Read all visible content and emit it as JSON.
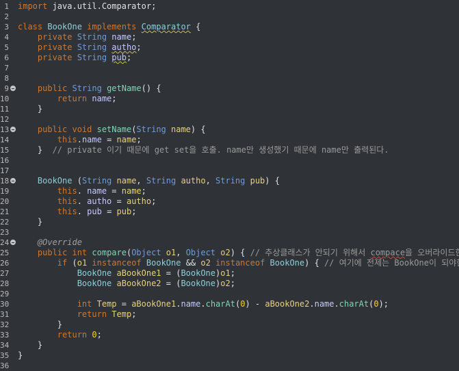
{
  "editor": {
    "lines": [
      [
        [
          "kw",
          "import "
        ],
        [
          "pl",
          "java.util.Comparator;"
        ]
      ],
      [],
      [
        [
          "kw",
          "class "
        ],
        [
          "cls",
          "BookOne "
        ],
        [
          "kw",
          "implements "
        ],
        [
          "cls",
          "Comparator",
          "warn"
        ],
        [
          "pl",
          " {"
        ]
      ],
      [
        [
          "pl",
          "    "
        ],
        [
          "kw",
          "private "
        ],
        [
          "ty",
          "String "
        ],
        [
          "fld",
          "name"
        ],
        [
          "pl",
          ";"
        ]
      ],
      [
        [
          "pl",
          "    "
        ],
        [
          "kw",
          "private "
        ],
        [
          "ty",
          "String "
        ],
        [
          "fld",
          "autho",
          "warn"
        ],
        [
          "pl",
          ";"
        ]
      ],
      [
        [
          "pl",
          "    "
        ],
        [
          "kw",
          "private "
        ],
        [
          "ty",
          "String "
        ],
        [
          "fld",
          "pub",
          "warn"
        ],
        [
          "pl",
          ";"
        ]
      ],
      [],
      [],
      [
        [
          "pl",
          "    "
        ],
        [
          "kw",
          "public "
        ],
        [
          "ty",
          "String "
        ],
        [
          "mth",
          "getName"
        ],
        [
          "pl",
          "() {"
        ]
      ],
      [
        [
          "pl",
          "        "
        ],
        [
          "kw",
          "return "
        ],
        [
          "fld",
          "name"
        ],
        [
          "pl",
          ";"
        ]
      ],
      [
        [
          "pl",
          "    }"
        ]
      ],
      [],
      [
        [
          "pl",
          "    "
        ],
        [
          "kw",
          "public "
        ],
        [
          "kw",
          "void "
        ],
        [
          "mth",
          "setName"
        ],
        [
          "pl",
          "("
        ],
        [
          "ty",
          "String "
        ],
        [
          "loc",
          "name"
        ],
        [
          "pl",
          ") {"
        ]
      ],
      [
        [
          "pl",
          "        "
        ],
        [
          "kw",
          "this"
        ],
        [
          "pl",
          "."
        ],
        [
          "fld",
          "name"
        ],
        [
          "pl",
          " = "
        ],
        [
          "loc",
          "name"
        ],
        [
          "pl",
          ";"
        ]
      ],
      [
        [
          "pl",
          "    }  "
        ],
        [
          "cm",
          "// private 이기 때문에 get set을 호출. name만 생성했기 때문에 name만 출력된다."
        ]
      ],
      [],
      [],
      [
        [
          "pl",
          "    "
        ],
        [
          "cls",
          "BookOne "
        ],
        [
          "pl",
          "("
        ],
        [
          "ty",
          "String "
        ],
        [
          "loc",
          "name"
        ],
        [
          "pl",
          ", "
        ],
        [
          "ty",
          "String "
        ],
        [
          "loc",
          "autho"
        ],
        [
          "pl",
          ", "
        ],
        [
          "ty",
          "String "
        ],
        [
          "loc",
          "pub"
        ],
        [
          "pl",
          ") {"
        ]
      ],
      [
        [
          "pl",
          "        "
        ],
        [
          "kw",
          "this"
        ],
        [
          "pl",
          ". "
        ],
        [
          "fld",
          "name"
        ],
        [
          "pl",
          " = "
        ],
        [
          "loc",
          "name"
        ],
        [
          "pl",
          ";"
        ]
      ],
      [
        [
          "pl",
          "        "
        ],
        [
          "kw",
          "this"
        ],
        [
          "pl",
          ". "
        ],
        [
          "fld",
          "autho"
        ],
        [
          "pl",
          " = "
        ],
        [
          "loc",
          "autho"
        ],
        [
          "pl",
          ";"
        ]
      ],
      [
        [
          "pl",
          "        "
        ],
        [
          "kw",
          "this"
        ],
        [
          "pl",
          ". "
        ],
        [
          "fld",
          "pub"
        ],
        [
          "pl",
          " = "
        ],
        [
          "loc",
          "pub"
        ],
        [
          "pl",
          ";"
        ]
      ],
      [
        [
          "pl",
          "    }"
        ]
      ],
      [],
      [
        [
          "pl",
          "    "
        ],
        [
          "ann",
          "@Override"
        ]
      ],
      [
        [
          "pl",
          "    "
        ],
        [
          "kw",
          "public "
        ],
        [
          "kw",
          "int "
        ],
        [
          "mth",
          "compare"
        ],
        [
          "pl",
          "("
        ],
        [
          "ty",
          "Object "
        ],
        [
          "loc",
          "o1"
        ],
        [
          "pl",
          ", "
        ],
        [
          "ty",
          "Object "
        ],
        [
          "loc",
          "o2"
        ],
        [
          "pl",
          ") { "
        ],
        [
          "cm",
          "// 추상클래스가 안되기 위해서 "
        ],
        [
          "cm",
          "compace",
          "err"
        ],
        [
          "cm",
          "을 오버라이드한다."
        ]
      ],
      [
        [
          "pl",
          "        "
        ],
        [
          "kw",
          "if "
        ],
        [
          "pl",
          "("
        ],
        [
          "loc",
          "o1 "
        ],
        [
          "kw",
          "instanceof "
        ],
        [
          "cls",
          "BookOne "
        ],
        [
          "pl",
          "&& "
        ],
        [
          "loc",
          "o2 "
        ],
        [
          "kw",
          "instanceof "
        ],
        [
          "cls",
          "BookOne"
        ],
        [
          "pl",
          ") { "
        ],
        [
          "cm",
          "// 여기에 전제는 BookOne이 되야한다."
        ]
      ],
      [
        [
          "pl",
          "            "
        ],
        [
          "cls",
          "BookOne "
        ],
        [
          "loc",
          "aBookOne1"
        ],
        [
          "pl",
          " = ("
        ],
        [
          "cls",
          "BookOne"
        ],
        [
          "pl",
          ")"
        ],
        [
          "loc",
          "o1"
        ],
        [
          "pl",
          ";"
        ]
      ],
      [
        [
          "pl",
          "            "
        ],
        [
          "cls",
          "BookOne "
        ],
        [
          "loc",
          "aBookOne2"
        ],
        [
          "pl",
          " = ("
        ],
        [
          "cls",
          "BookOne"
        ],
        [
          "pl",
          ")"
        ],
        [
          "loc",
          "o2"
        ],
        [
          "pl",
          ";"
        ]
      ],
      [],
      [
        [
          "pl",
          "            "
        ],
        [
          "kw",
          "int "
        ],
        [
          "loc",
          "Temp"
        ],
        [
          "pl",
          " = "
        ],
        [
          "loc",
          "aBookOne1"
        ],
        [
          "pl",
          "."
        ],
        [
          "fld",
          "name"
        ],
        [
          "pl",
          "."
        ],
        [
          "mth",
          "charAt"
        ],
        [
          "pl",
          "("
        ],
        [
          "num",
          "0"
        ],
        [
          "pl",
          ") - "
        ],
        [
          "loc",
          "aBookOne2"
        ],
        [
          "pl",
          "."
        ],
        [
          "fld",
          "name"
        ],
        [
          "pl",
          "."
        ],
        [
          "mth",
          "charAt"
        ],
        [
          "pl",
          "("
        ],
        [
          "num",
          "0"
        ],
        [
          "pl",
          ");"
        ]
      ],
      [
        [
          "pl",
          "            "
        ],
        [
          "kw",
          "return "
        ],
        [
          "loc",
          "Temp"
        ],
        [
          "pl",
          ";"
        ]
      ],
      [
        [
          "pl",
          "        }"
        ]
      ],
      [
        [
          "pl",
          "        "
        ],
        [
          "kw",
          "return "
        ],
        [
          "num",
          "0"
        ],
        [
          "pl",
          ";"
        ]
      ],
      [
        [
          "pl",
          "    }"
        ]
      ],
      [
        [
          "pl",
          "}"
        ]
      ],
      []
    ],
    "fold_markers": [
      9,
      13,
      18,
      24
    ]
  }
}
